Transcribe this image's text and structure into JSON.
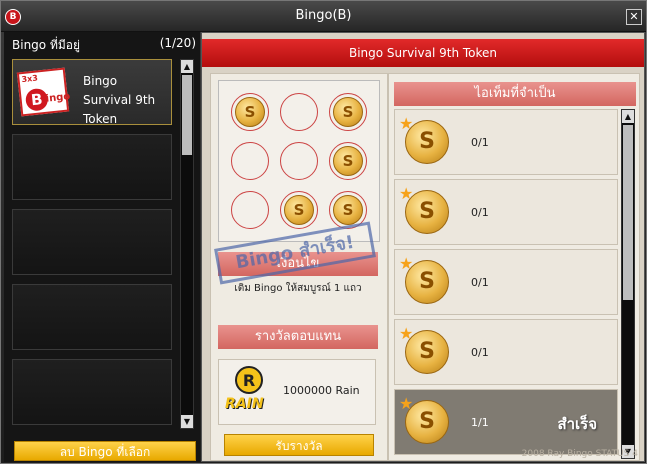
{
  "window": {
    "title": "Bingo(B)",
    "logo": "B",
    "close_icon": "✕"
  },
  "left": {
    "header": "Bingo ที่มีอยู่",
    "count": "(1/20)",
    "items": [
      {
        "name": "Bingo Survival 9th Token",
        "thumb_tag": "3x3",
        "thumb_b": "B",
        "thumb_ingo": "ingo"
      }
    ],
    "delete_button": "ลบ Bingo  ที่เลือก",
    "scroll_up": "▲",
    "scroll_down": "▼"
  },
  "right": {
    "title": "Bingo Survival 9th Token",
    "board": {
      "cells": [
        true,
        false,
        true,
        false,
        false,
        true,
        false,
        true,
        true
      ],
      "coin_letter": "S"
    },
    "stamp_text": "Bingo สำเร็จ!",
    "status_header": "เงื่อนไข",
    "status_text": "เติม Bingo ให้สมบูรณ์ 1 แถว",
    "reward_header": "รางวัลตอบแทน",
    "reward": {
      "logo_r": "R",
      "logo_text": "RAIN",
      "text": "1000000 Rain"
    },
    "claim_button": "รับรางวัล",
    "items_header": "ไอเท็มที่จำเป็น",
    "items": [
      {
        "count": "0/1",
        "done": false
      },
      {
        "count": "0/1",
        "done": false
      },
      {
        "count": "0/1",
        "done": false
      },
      {
        "count": "0/1",
        "done": false
      },
      {
        "count": "1/1",
        "done": true,
        "done_label": "สำเร็จ"
      }
    ],
    "watermark": "2008 Ray Bingo STATUS 4"
  },
  "colors": {
    "accent_red": "#c8151b",
    "button_yellow": "#f4c21a"
  }
}
